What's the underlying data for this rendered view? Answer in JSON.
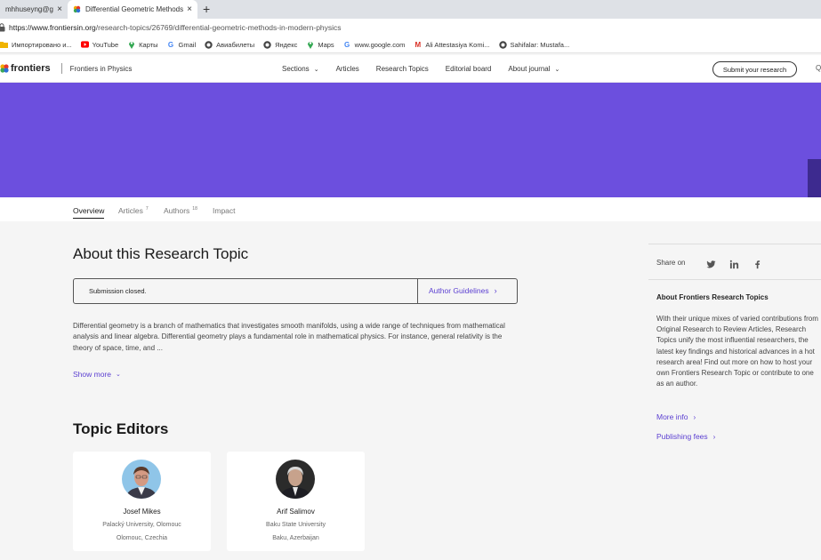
{
  "browser": {
    "tabs": [
      {
        "title": "mhhuseyng@gm",
        "close": "×"
      },
      {
        "title": "Differential Geometric Methods",
        "close": "×"
      }
    ],
    "new_tab": "+",
    "url_host": "https://www.frontiersin.org",
    "url_path": "/research-topics/26769/differential-geometric-methods-in-modern-physics",
    "bookmarks": [
      {
        "label": "Импортировано и...",
        "icon": "folder-icon"
      },
      {
        "label": "YouTube",
        "icon": "youtube-icon"
      },
      {
        "label": "Карты",
        "icon": "maps-pin-icon"
      },
      {
        "label": "Gmail",
        "icon": "google-icon"
      },
      {
        "label": "Авиабилеты",
        "icon": "globe-icon"
      },
      {
        "label": "Яндекс",
        "icon": "globe-icon"
      },
      {
        "label": "Maps",
        "icon": "maps-pin-icon"
      },
      {
        "label": "www.google.com",
        "icon": "google-icon"
      },
      {
        "label": "Ali Attestasiya Komi...",
        "icon": "gmail-icon"
      },
      {
        "label": "Sahifalar: Mustafa...",
        "icon": "globe-icon"
      }
    ]
  },
  "site_header": {
    "logo": "frontiers",
    "journal": "Frontiers in Physics",
    "nav": [
      {
        "label": "Sections",
        "dropdown": true
      },
      {
        "label": "Articles",
        "dropdown": false
      },
      {
        "label": "Research Topics",
        "dropdown": false
      },
      {
        "label": "Editorial board",
        "dropdown": false
      },
      {
        "label": "About journal",
        "dropdown": true
      }
    ],
    "submit_label": "Submit your research",
    "search_glyph": "Q"
  },
  "topic_tabs": [
    {
      "label": "Overview",
      "count": "",
      "active": true
    },
    {
      "label": "Articles",
      "count": "7",
      "active": false
    },
    {
      "label": "Authors",
      "count": "18",
      "active": false
    },
    {
      "label": "Impact",
      "count": "",
      "active": false
    }
  ],
  "about": {
    "heading": "About this Research Topic",
    "status": "Submission closed.",
    "guidelines_label": "Author Guidelines",
    "description": "Differential geometry is a branch of mathematics that investigates smooth manifolds, using a wide range of techniques from mathematical analysis and linear algebra. Differential geometry plays a fundamental role in mathematical physics. For instance, general relativity is the theory of space, time, and ...",
    "show_more": "Show more"
  },
  "editors": {
    "heading": "Topic Editors",
    "people": [
      {
        "name": "Josef Mikes",
        "affiliation": "Palacký University, Olomouc",
        "location": "Olomouc, Czechia"
      },
      {
        "name": "Arif Salimov",
        "affiliation": "Baku State University",
        "location": "Baku, Azerbaijan"
      }
    ]
  },
  "sidebar": {
    "share_label": "Share on",
    "share_icons": [
      "twitter-icon",
      "linkedin-icon",
      "facebook-icon"
    ],
    "about_heading": "About Frontiers Research Topics",
    "about_text": "With their unique mixes of varied contributions from Original Research to Review Articles, Research Topics unify the most influential researchers, the latest key findings and historical advances in a hot research area! Find out more on how to host your own Frontiers Research Topic or contribute to one as an author.",
    "more_info": "More info",
    "publishing_fees": "Publishing fees"
  },
  "colors": {
    "banner": "#6c4fde",
    "link": "#5b3fd1"
  }
}
